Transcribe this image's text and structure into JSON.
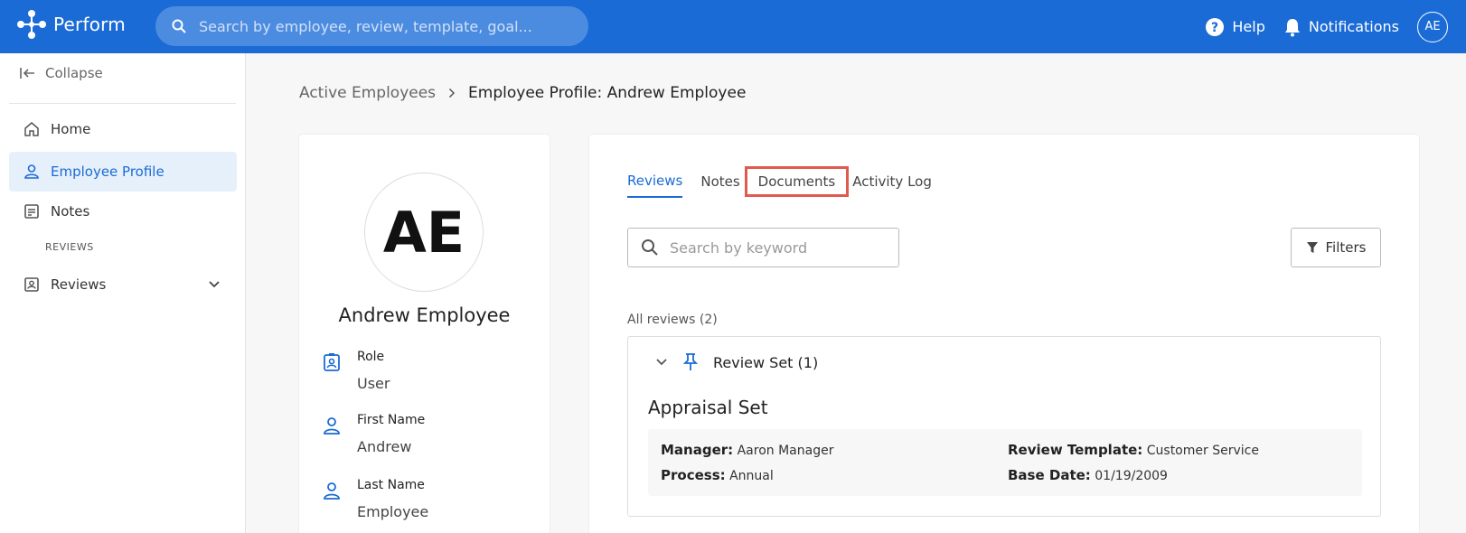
{
  "app": {
    "name": "Perform"
  },
  "header": {
    "search_placeholder": "Search by employee, review, template, goal...",
    "help_label": "Help",
    "notifications_label": "Notifications",
    "user_initials": "AE"
  },
  "sidebar": {
    "collapse_label": "Collapse",
    "items": [
      {
        "label": "Home",
        "icon": "home-icon"
      },
      {
        "label": "Employee Profile",
        "icon": "person-icon",
        "active": true
      },
      {
        "label": "Notes",
        "icon": "notes-icon"
      }
    ],
    "section_label": "REVIEWS",
    "reviews_label": "Reviews"
  },
  "breadcrumb": {
    "parent": "Active Employees",
    "current": "Employee Profile: Andrew Employee"
  },
  "profile": {
    "initials": "AE",
    "name": "Andrew Employee",
    "fields": [
      {
        "label": "Role",
        "value": "User",
        "icon": "badge-icon"
      },
      {
        "label": "First Name",
        "value": "Andrew",
        "icon": "person-icon"
      },
      {
        "label": "Last Name",
        "value": "Employee",
        "icon": "person-icon"
      }
    ]
  },
  "tabs": [
    {
      "label": "Reviews",
      "active": true
    },
    {
      "label": "Notes"
    },
    {
      "label": "Documents",
      "highlighted": true
    },
    {
      "label": "Activity Log"
    }
  ],
  "keyword_search_placeholder": "Search by keyword",
  "filters_label": "Filters",
  "reviews": {
    "count_label": "All reviews (2)",
    "set_label": "Review Set (1)",
    "title": "Appraisal Set",
    "manager_label": "Manager:",
    "manager_value": "Aaron Manager",
    "process_label": "Process:",
    "process_value": "Annual",
    "template_label": "Review Template:",
    "template_value": "Customer Service",
    "base_date_label": "Base Date:",
    "base_date_value": "01/19/2009"
  },
  "colors": {
    "brand": "#1a6bd6",
    "highlight": "#e05a4f"
  }
}
